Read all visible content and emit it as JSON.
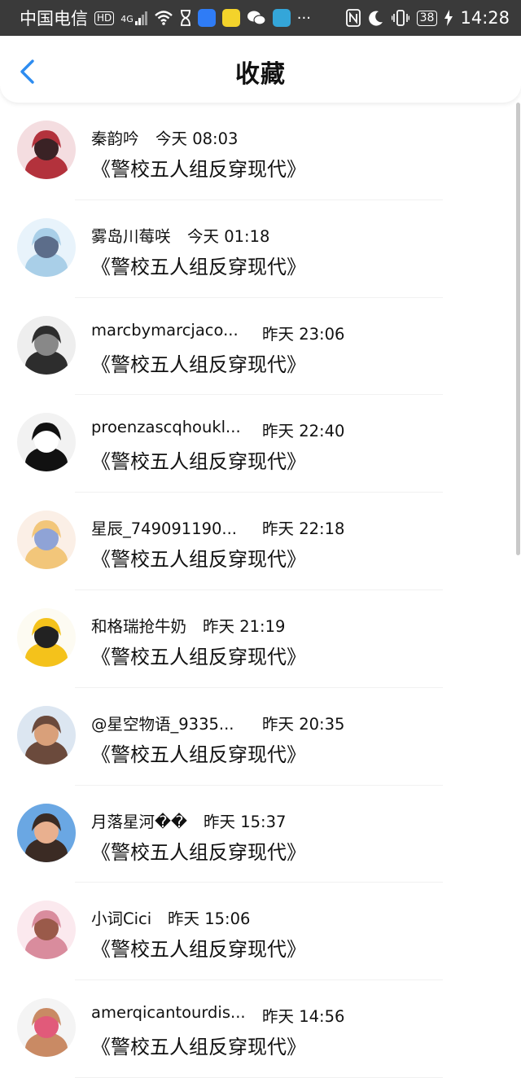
{
  "status_bar": {
    "carrier": "中国电信",
    "hd": "HD",
    "network": "4G",
    "battery": "38",
    "time": "14:28",
    "app_icon_colors": [
      "#2f7cf6",
      "#f3d32b",
      "#dddddd",
      "#34a6d9"
    ]
  },
  "header": {
    "title": "收藏",
    "back_icon": "chevron-left-icon",
    "accent": "#2d8cf0"
  },
  "favorites": [
    {
      "name": "秦韵吟",
      "time": "今天 08:03",
      "title": "《警校五人组反穿现代》",
      "avatar": {
        "bg": "#f4dde0",
        "fg": "#b3323c",
        "accent": "#3a2225"
      }
    },
    {
      "name": "雾岛川莓咲",
      "time": "今天 01:18",
      "title": "《警校五人组反穿现代》",
      "avatar": {
        "bg": "#e8f3fb",
        "fg": "#a9cfe8",
        "accent": "#5c6d8a"
      }
    },
    {
      "name": "marcbymarcjaco...",
      "time": "昨天 23:06",
      "title": "《警校五人组反穿现代》",
      "avatar": {
        "bg": "#eeeeee",
        "fg": "#2d2d2d",
        "accent": "#888888"
      }
    },
    {
      "name": "proenzascqhoukl...",
      "time": "昨天 22:40",
      "title": "《警校五人组反穿现代》",
      "avatar": {
        "bg": "#f2f2f2",
        "fg": "#111111",
        "accent": "#ffffff"
      }
    },
    {
      "name": "星辰_749091190...",
      "time": "昨天 22:18",
      "title": "《警校五人组反穿现代》",
      "avatar": {
        "bg": "#fbefe6",
        "fg": "#f2c67a",
        "accent": "#8fa3d6"
      }
    },
    {
      "name": "和格瑞抢牛奶",
      "time": "昨天 21:19",
      "title": "《警校五人组反穿现代》",
      "avatar": {
        "bg": "#fdfbf2",
        "fg": "#f4c21b",
        "accent": "#222222"
      }
    },
    {
      "name": "@星空物语_9335...",
      "time": "昨天 20:35",
      "title": "《警校五人组反穿现代》",
      "avatar": {
        "bg": "#dce6f1",
        "fg": "#6b4a3c",
        "accent": "#d9a07a"
      }
    },
    {
      "name": "月落星河��",
      "time": "昨天 15:37",
      "title": "《警校五人组反穿现代》",
      "avatar": {
        "bg": "#6aa7e3",
        "fg": "#3b2b24",
        "accent": "#e9b08f"
      }
    },
    {
      "name": "小词Cici",
      "time": "昨天 15:06",
      "title": "《警校五人组反穿现代》",
      "avatar": {
        "bg": "#fbe9ee",
        "fg": "#d98c9d",
        "accent": "#9a5a4a"
      }
    },
    {
      "name": "amerqicantourdis...",
      "time": "昨天 14:56",
      "title": "《警校五人组反穿现代》",
      "avatar": {
        "bg": "#f4f4f4",
        "fg": "#c98a64",
        "accent": "#e15a7a"
      }
    }
  ]
}
